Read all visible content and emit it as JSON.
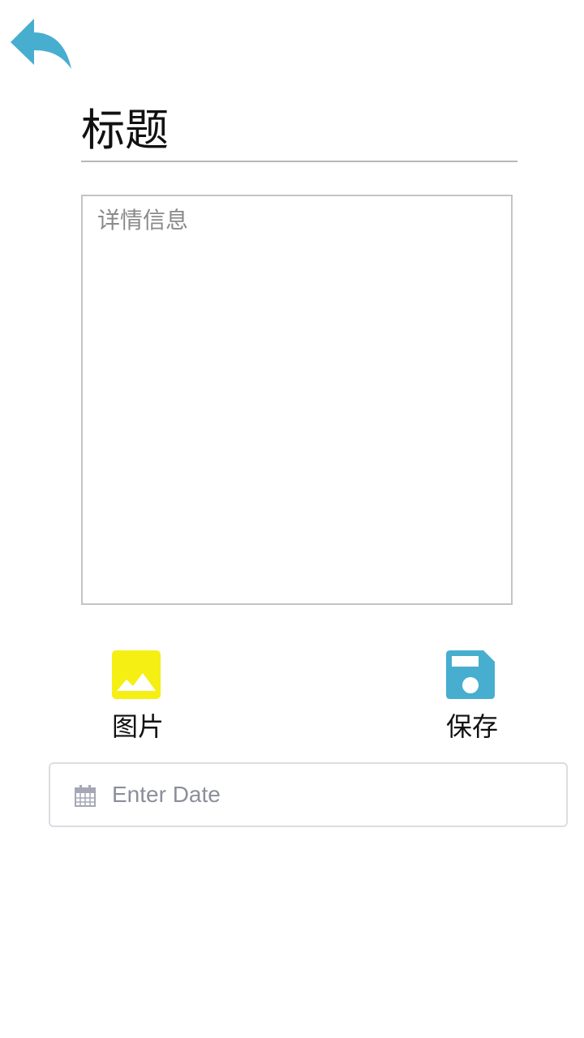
{
  "header": {
    "back_icon": "undo-arrow-icon",
    "back_color": "#47aed0"
  },
  "form": {
    "title_value": "标题",
    "detail_placeholder": "详情信息"
  },
  "actions": {
    "image": {
      "label": "图片",
      "icon": "image-icon",
      "color": "#f5ef14"
    },
    "save": {
      "label": "保存",
      "icon": "floppy-disk-icon",
      "color": "#47aed0"
    }
  },
  "date": {
    "placeholder": "Enter Date",
    "icon": "calendar-icon"
  }
}
